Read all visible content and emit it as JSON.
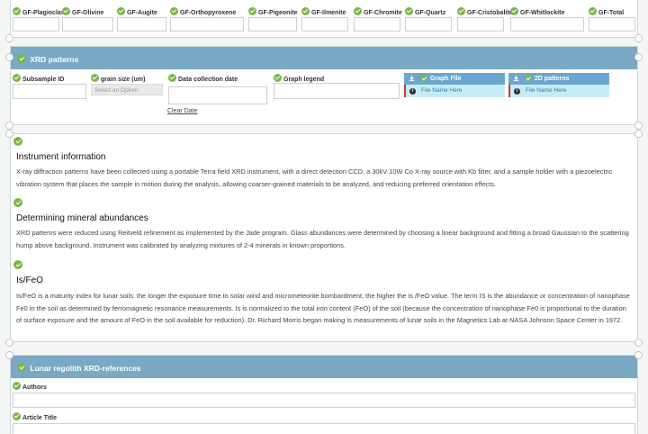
{
  "gf_fields": [
    {
      "label": "GF-Plagioclase"
    },
    {
      "label": "GF-Olivine"
    },
    {
      "label": "GF-Augite"
    },
    {
      "label": "GF-Orthopyroxene"
    },
    {
      "label": "GF-Pigeonite"
    },
    {
      "label": "GF-Ilmenite"
    },
    {
      "label": "GF-Chromite"
    },
    {
      "label": "GF-Quartz"
    },
    {
      "label": "GF-Cristobalite"
    },
    {
      "label": "GF-Whitlockite"
    },
    {
      "label": "GF-Total"
    }
  ],
  "xrd": {
    "title": "XRD patterns",
    "subsample_label": "Subsample ID",
    "grain_label": "grain size (um)",
    "grain_placeholder": "Select an Option",
    "date_label": "Data collection date",
    "clear_date": "Clear Date",
    "legend_label": "Graph legend",
    "graph_file_title": "Graph File",
    "graph_file_placeholder": "File Name Here",
    "patterns_title": "2D patterns",
    "patterns_placeholder": "File Name Here"
  },
  "info": {
    "instrument_title": "Instrument information",
    "instrument_text": "X-ray diffraction patterns have been collected using a portable Terra field XRD instrument, with a direct detection CCD, a 30kV 10W Co X-ray source with Kb filter, and a sample holder with a piezoelectric vibration system that places the sample in motion during the analysis, allowing coarser-grained materials to be analyzed, and reducing preferred orientation effects.",
    "abundance_title": "Determining mineral abundances",
    "abundance_text": "XRD patterns were reduced using Reitveld refinement as implemented by the Jade program. Glass abundances were determined by choosing a linear background and fitting a broad Gaussian to the scattering hump above background. Instrument was calibrated by analyzing mixtures of 2-4 minerals in known proportions.",
    "isfeo_title": "Is/FeO",
    "isfeo_text": "Is/FeO is a maturity index for lunar soils: the longer the exposure time to solar wind and micrometeorite bombardment, the higher the is /FeO value. The term IS is the abundance or concentration of nanophase Fe0 in the soil as determined by ferromagnetic resonance measurements. Is is normalized to the total iron content (FeO) of the soil (because the concentration of nanophase Fe0 is proportional to the duration of surface exposure and the amount of FeO in the soil available for reduction). Dr. Richard Morris began making Is measurements of lunar soils in the Magnetics Lab at NASA Johnson Space Center in 1972."
  },
  "refs": {
    "title": "Lunar regolith XRD-references",
    "authors_label": "Authors",
    "article_label": "Article Title"
  },
  "colors": {
    "panel_header": "#7aa9c6",
    "check_green": "#7ab648",
    "file_header": "#6aa6cf",
    "file_body": "#c6ecf6"
  }
}
